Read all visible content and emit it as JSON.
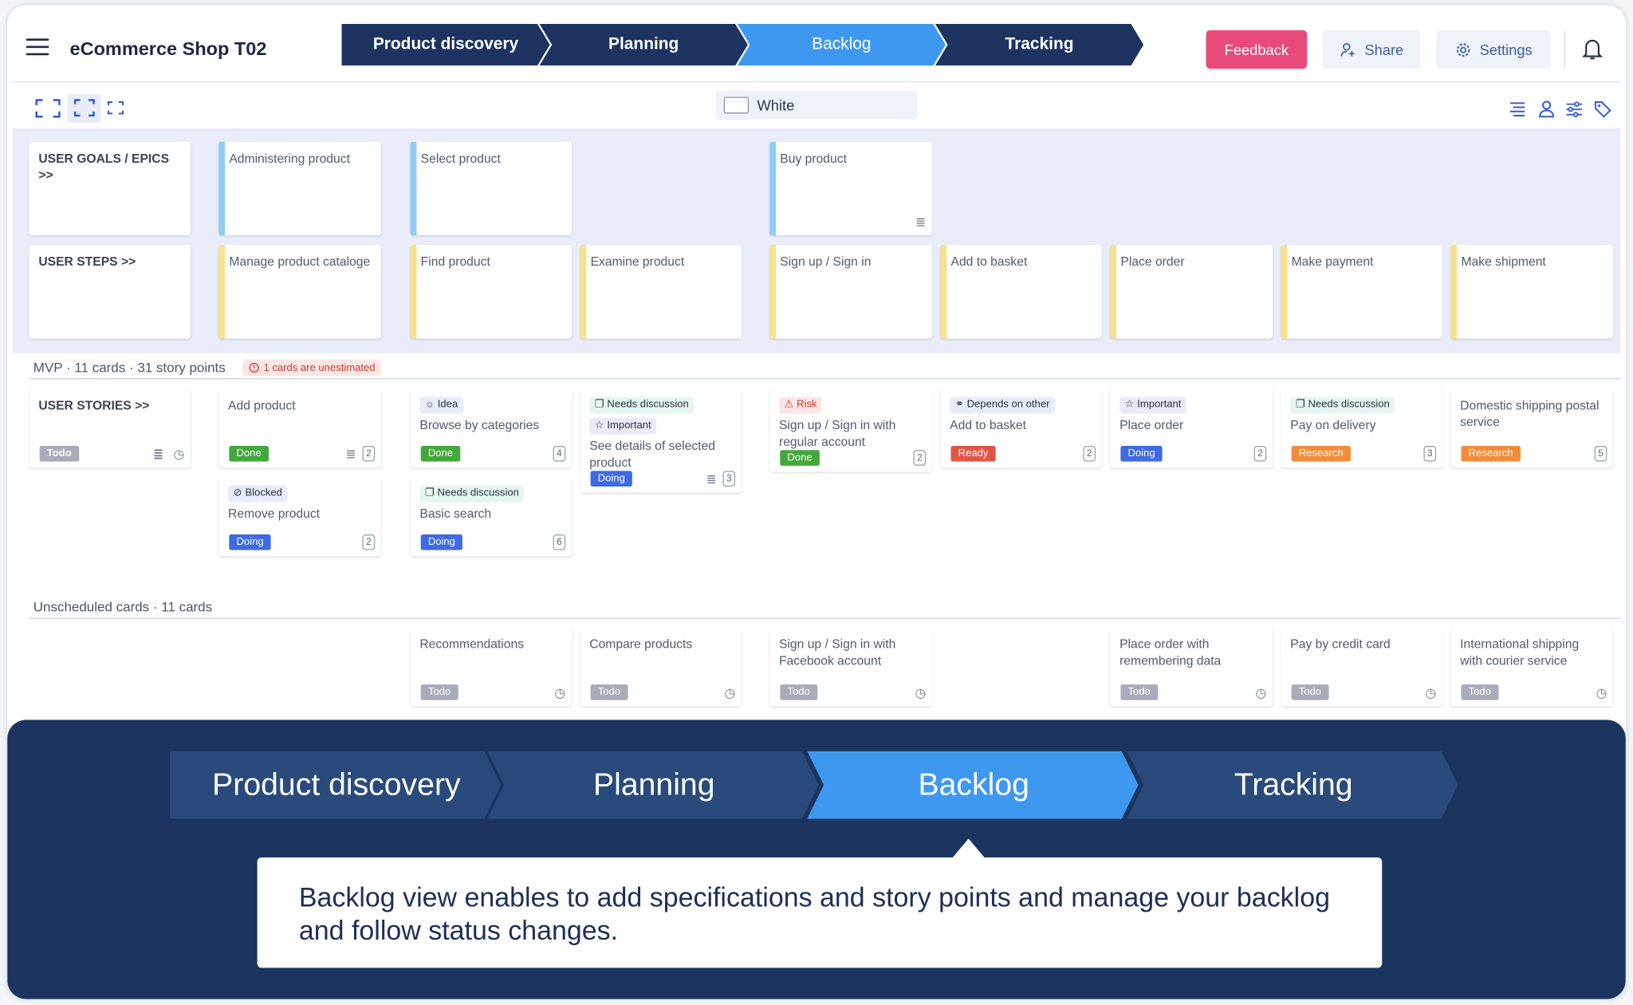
{
  "header": {
    "title": "eCommerce Shop T02",
    "menu_icon": "hamburger-menu-icon",
    "stages": [
      "Product discovery",
      "Planning",
      "Backlog",
      "Tracking"
    ],
    "active_stage": "Backlog",
    "feedback": "Feedback",
    "share": "Share",
    "settings": "Settings"
  },
  "toolbar": {
    "color_label": "White"
  },
  "rows": {
    "goals": "USER GOALS / EPICS >>",
    "steps": "USER STEPS >>",
    "stories": "USER STORIES >>"
  },
  "goals": [
    "Administering product",
    "Select product",
    "Buy product"
  ],
  "steps": [
    "Manage product cataloge",
    "Find product",
    "Examine product",
    "Sign up / Sign in",
    "Add to basket",
    "Place order",
    "Make payment",
    "Make shipment"
  ],
  "mvp": {
    "title": "MVP · 11 cards · 31 story points",
    "warning": "1 cards are unestimated"
  },
  "stories": {
    "label_status": "Todo",
    "c1": {
      "title": "Add product",
      "status": "Done",
      "points": "2"
    },
    "c2": {
      "tag": "Blocked",
      "title": "Remove product",
      "status": "Doing",
      "points": "2"
    },
    "c3": {
      "tag": "Idea",
      "title": "Browse by categories",
      "status": "Done",
      "points": "4"
    },
    "c4": {
      "tag": "Needs discussion",
      "title": "Basic search",
      "status": "Doing",
      "points": "6"
    },
    "c5": {
      "tag1": "Needs discussion",
      "tag2": "Important",
      "title": "See details of selected product",
      "status": "Doing",
      "points": "3"
    },
    "c6": {
      "tag": "Risk",
      "title": "Sign up / Sign in with regular account",
      "status": "Done",
      "points": "2"
    },
    "c7": {
      "tag": "Depends on other",
      "title": "Add to basket",
      "status": "Ready",
      "points": "2"
    },
    "c8": {
      "tag": "Important",
      "title": "Place order",
      "status": "Doing",
      "points": "2"
    },
    "c9": {
      "tag": "Needs discussion",
      "title": "Pay on delivery",
      "status": "Research",
      "points": "3"
    },
    "c10": {
      "title": "Domestic shipping postal service",
      "status": "Research",
      "points": "5"
    }
  },
  "unscheduled": {
    "title": "Unscheduled cards · 11 cards",
    "status": "Todo",
    "cards": [
      "Recommendations",
      "Compare products",
      "Sign up / Sign in with Facebook account",
      "Place order with remembering data",
      "Pay by credit card",
      "International shipping with courier service"
    ]
  },
  "overlay": {
    "stages": [
      "Product discovery",
      "Planning",
      "Backlog",
      "Tracking"
    ],
    "text": "Backlog view enables to add specifications and story points and manage your backlog and follow status changes."
  },
  "colors": {
    "navy": "#1d3461",
    "active": "#3f98f0",
    "feedback": "#e84a7a",
    "overlay_bg": "#1c3560"
  }
}
